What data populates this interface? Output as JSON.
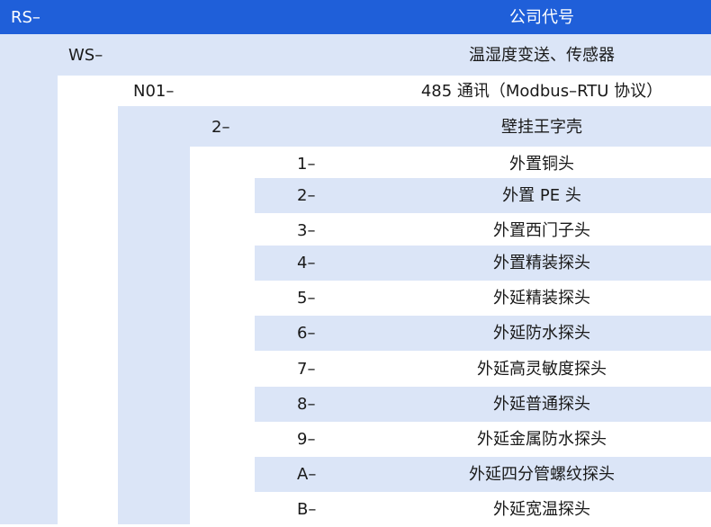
{
  "header": {
    "code": "RS–",
    "title": "公司代号"
  },
  "levels": {
    "ws": {
      "code": "WS–",
      "desc": "温湿度变送、传感器"
    },
    "n01": {
      "code": "N01–",
      "desc": "485 通讯（Modbus–RTU 协议）"
    },
    "shell": {
      "code": "2–",
      "desc": "壁挂王字壳"
    }
  },
  "items": [
    {
      "code": "1–",
      "desc": "外置铜头"
    },
    {
      "code": "2–",
      "desc": "外置 PE 头"
    },
    {
      "code": "3–",
      "desc": "外置西门子头"
    },
    {
      "code": "4–",
      "desc": "外置精装探头"
    },
    {
      "code": "5–",
      "desc": "外延精装探头"
    },
    {
      "code": "6–",
      "desc": "外延防水探头"
    },
    {
      "code": "7–",
      "desc": "外延高灵敏度探头"
    },
    {
      "code": "8–",
      "desc": "外延普通探头"
    },
    {
      "code": "9–",
      "desc": "外延金属防水探头"
    },
    {
      "code": "A–",
      "desc": "外延四分管螺纹探头"
    },
    {
      "code": "B–",
      "desc": "外延宽温探头"
    }
  ]
}
